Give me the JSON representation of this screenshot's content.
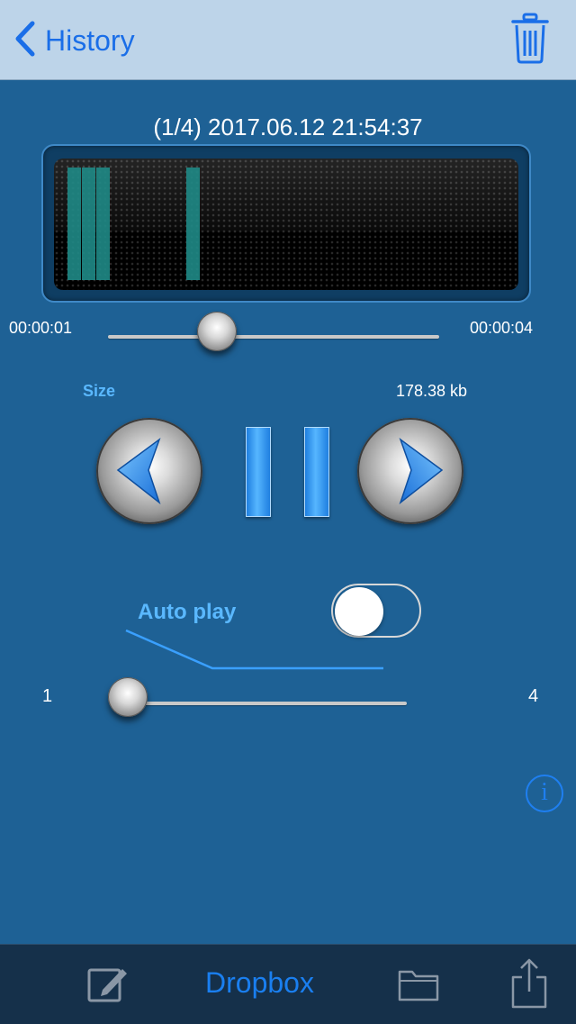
{
  "navbar": {
    "back_label": "History",
    "back_icon": "chevron-left-icon",
    "trash_icon": "trash-icon"
  },
  "recording": {
    "timestamp": "(1/4) 2017.06.12 21:54:37"
  },
  "playback": {
    "current_time": "00:00:01",
    "total_time": "00:00:04",
    "position_fraction": 0.33
  },
  "file": {
    "size_label": "Size",
    "size_value": "178.38  kb"
  },
  "controls": {
    "prev_icon": "prev-arrow-icon",
    "pause_icon": "pause-icon",
    "next_icon": "next-arrow-icon"
  },
  "autoplay": {
    "label": "Auto play",
    "enabled": false
  },
  "track_selector": {
    "min_label": "1",
    "max_label": "4",
    "value": 1
  },
  "info": {
    "icon_text": "i"
  },
  "toolbar": {
    "edit_icon": "edit-icon",
    "dropbox_label": "Dropbox",
    "folder_icon": "folder-icon",
    "share_icon": "share-icon"
  },
  "colors": {
    "background": "#1e6195",
    "accent": "#1a7ff0",
    "label_blue": "#5ab8ff",
    "waveform_bar": "#1f8a86"
  }
}
